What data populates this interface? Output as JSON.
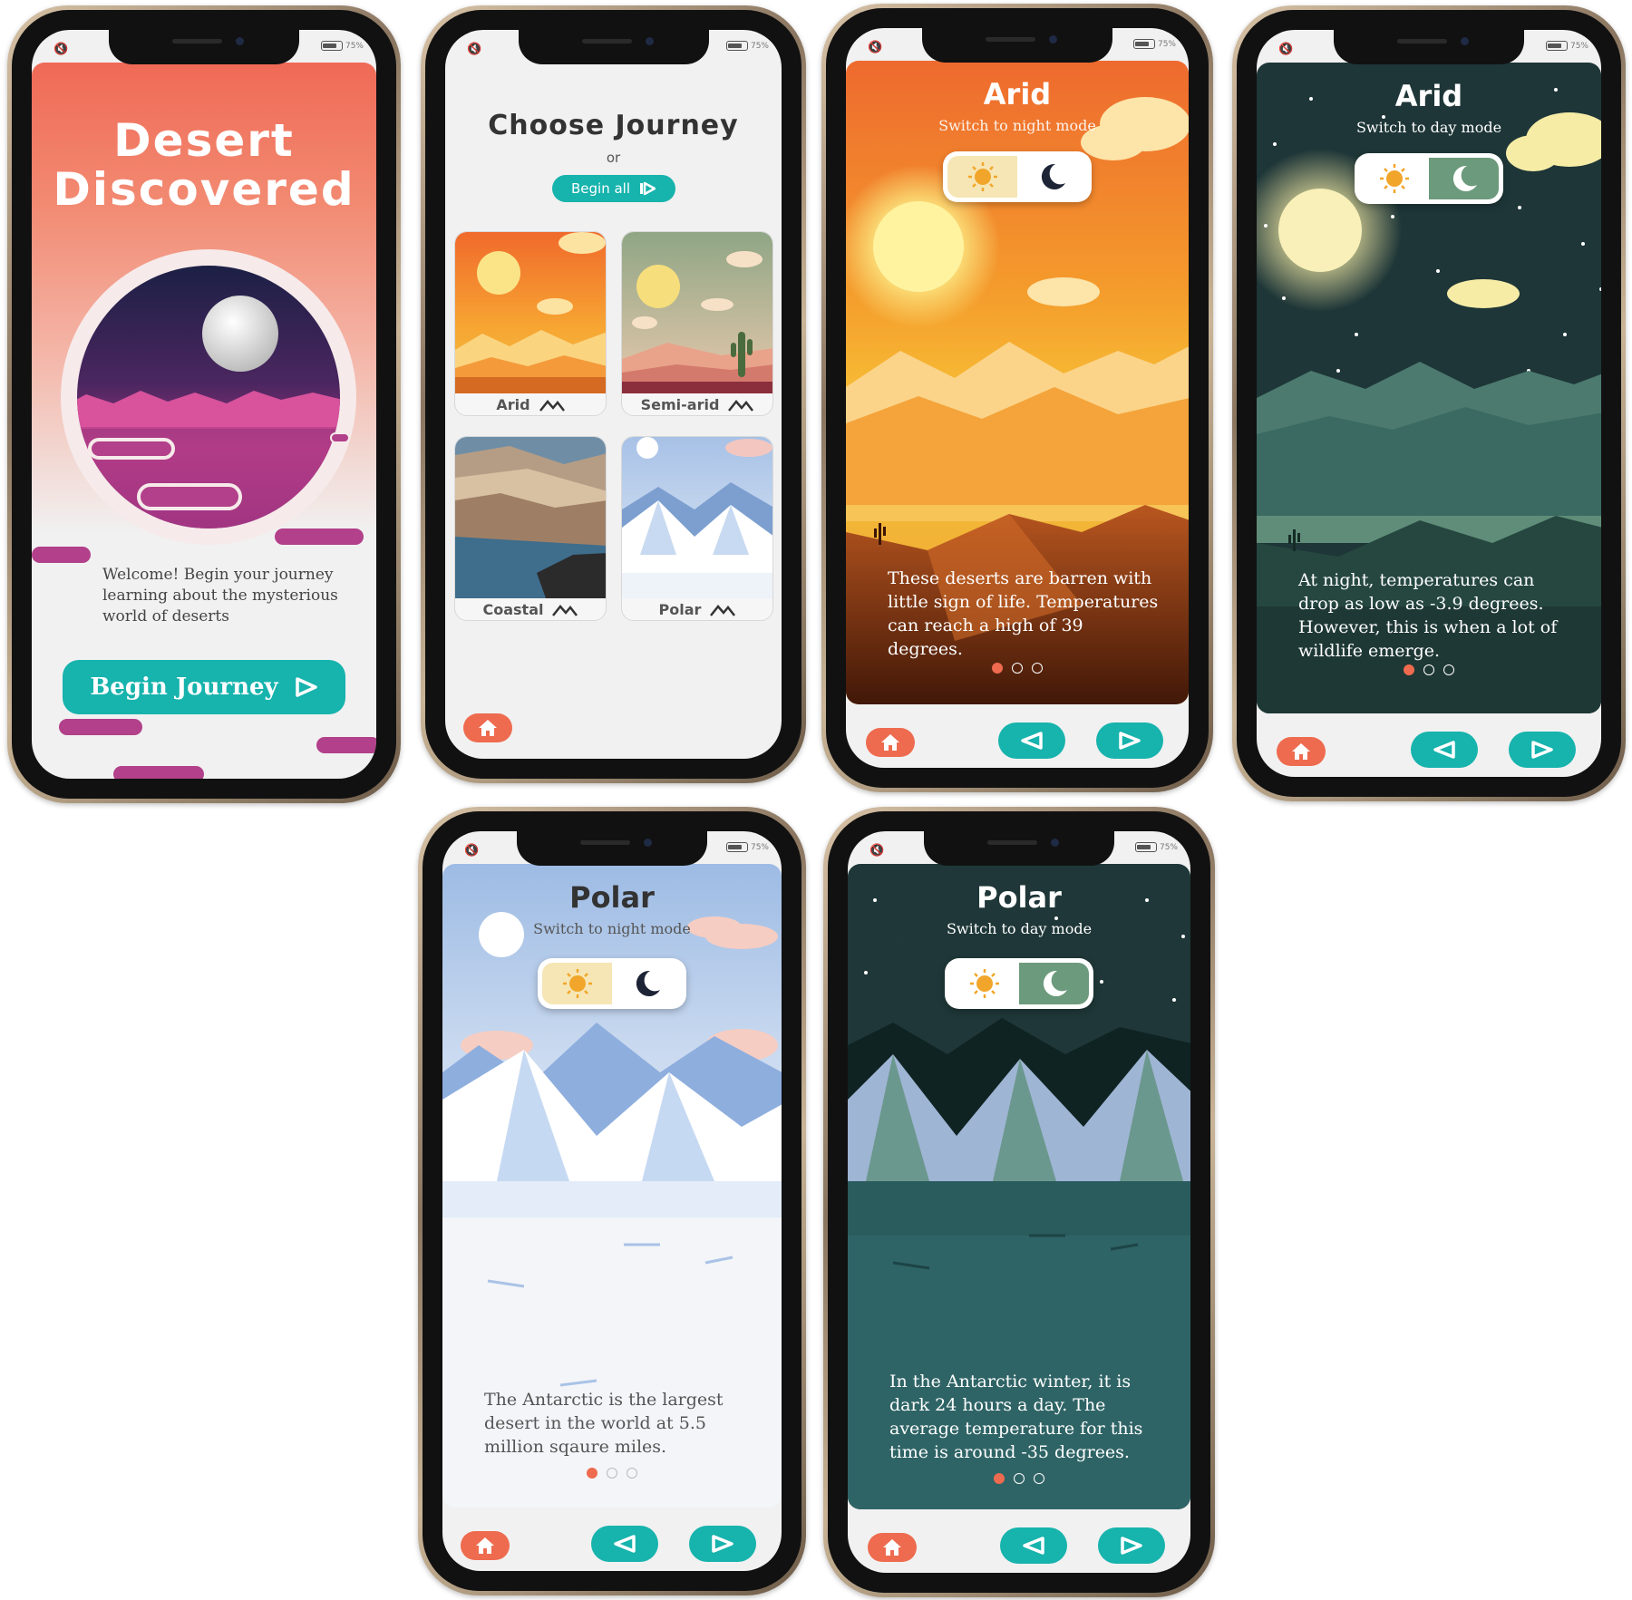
{
  "status": {
    "battery": "75%"
  },
  "welcome": {
    "title_line1": "Desert",
    "title_line2": "Discovered",
    "intro": "Welcome! Begin your journey learning about the mysterious world of deserts",
    "begin_button": "Begin Journey"
  },
  "choose": {
    "title": "Choose Journey",
    "or": "or",
    "begin_all": "Begin all",
    "cards": [
      {
        "label": "Arid"
      },
      {
        "label": "Semi-arid"
      },
      {
        "label": "Coastal"
      },
      {
        "label": "Polar"
      }
    ]
  },
  "arid_day": {
    "title": "Arid",
    "toggle_hint": "Switch to night mode",
    "text": "These deserts are barren with little sign of life. Temperatures can reach a high of 39 degrees."
  },
  "arid_night": {
    "title": "Arid",
    "toggle_hint": "Switch to day mode",
    "text": "At night, temperatures can drop as low as -3.9 degrees. However, this is when a lot of wildlife emerge."
  },
  "polar_day": {
    "title": "Polar",
    "toggle_hint": "Switch to night mode",
    "text": "The Antarctic is the largest desert in the world at 5.5 million sqaure miles."
  },
  "polar_night": {
    "title": "Polar",
    "toggle_hint": "Switch to day mode",
    "text": "In the Antarctic winter, it is dark 24 hours a day. The average temperature for this time is around -35 degrees."
  },
  "icons": {
    "home": "home-icon",
    "prev": "arrow-left-icon",
    "next": "arrow-right-icon",
    "sun": "sun-icon",
    "moon": "moon-icon",
    "mountain": "mountain-icon",
    "mute": "mute-icon"
  },
  "colors": {
    "accent_teal": "#17b3ad",
    "home_coral": "#ee6b4f",
    "pill_magenta": "#b2408a"
  },
  "pagination": {
    "current": 1,
    "total": 3
  }
}
